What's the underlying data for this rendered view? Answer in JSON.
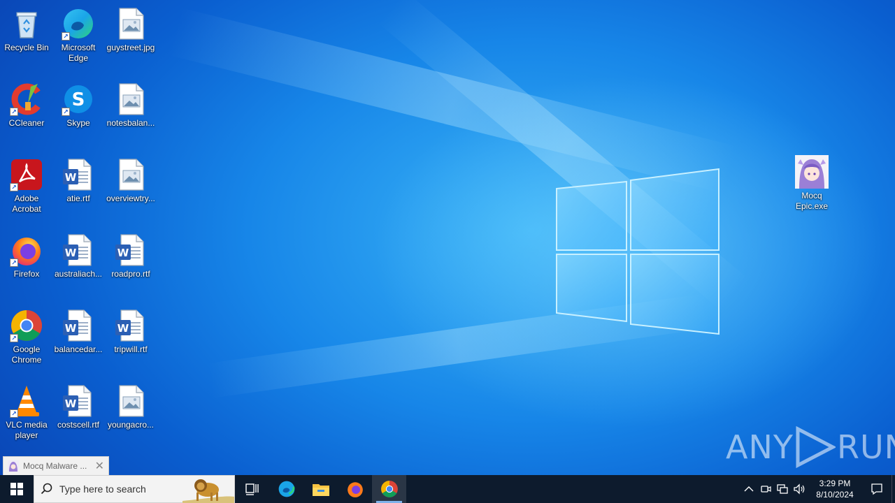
{
  "desktop": {
    "icons": [
      {
        "label": "Recycle Bin",
        "icon": "recycle-bin-icon"
      },
      {
        "label": "Microsoft Edge",
        "icon": "edge-icon"
      },
      {
        "label": "guystreet.jpg",
        "icon": "image-file-icon"
      },
      {
        "label": "CCleaner",
        "icon": "ccleaner-icon"
      },
      {
        "label": "Skype",
        "icon": "skype-icon"
      },
      {
        "label": "notesbalan...",
        "icon": "image-file-icon"
      },
      {
        "label": "Adobe Acrobat",
        "icon": "acrobat-icon"
      },
      {
        "label": "atie.rtf",
        "icon": "word-doc-icon"
      },
      {
        "label": "overviewtry...",
        "icon": "image-file-icon"
      },
      {
        "label": "Firefox",
        "icon": "firefox-icon"
      },
      {
        "label": "australiach...",
        "icon": "word-doc-icon"
      },
      {
        "label": "roadpro.rtf",
        "icon": "word-doc-icon"
      },
      {
        "label": "Google Chrome",
        "icon": "chrome-icon"
      },
      {
        "label": "balancedar...",
        "icon": "word-doc-icon"
      },
      {
        "label": "tripwill.rtf",
        "icon": "word-doc-icon"
      },
      {
        "label": "VLC media player",
        "icon": "vlc-icon"
      },
      {
        "label": "costscell.rtf",
        "icon": "word-doc-icon"
      },
      {
        "label": "youngacro...",
        "icon": "image-file-icon"
      },
      {
        "label": "Mocq Epic.exe",
        "icon": "anime-character-icon"
      }
    ]
  },
  "watermark": {
    "left": "ANY",
    "right": "RUN"
  },
  "toast": {
    "text": "Mocq Malware ...",
    "close": "✕"
  },
  "taskbar": {
    "search_placeholder": "Type here to search",
    "clock": {
      "time": "3:29 PM",
      "date": "8/10/2024"
    }
  }
}
